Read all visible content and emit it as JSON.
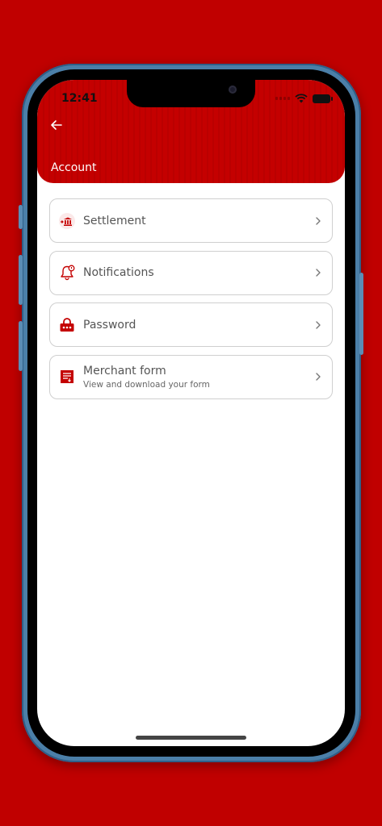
{
  "status_bar": {
    "time": "12:41"
  },
  "header": {
    "title": "Account"
  },
  "menu": [
    {
      "label": "Settlement",
      "subtitle": "",
      "icon": "bank-icon"
    },
    {
      "label": "Notifications",
      "subtitle": "",
      "icon": "bell-icon"
    },
    {
      "label": "Password",
      "subtitle": "",
      "icon": "lock-icon"
    },
    {
      "label": "Merchant form",
      "subtitle": "View and download your form",
      "icon": "form-icon"
    }
  ],
  "colors": {
    "brand_red": "#c40000",
    "background_red": "#c00000",
    "border": "#cfcfcf",
    "text_gray": "#555555"
  }
}
